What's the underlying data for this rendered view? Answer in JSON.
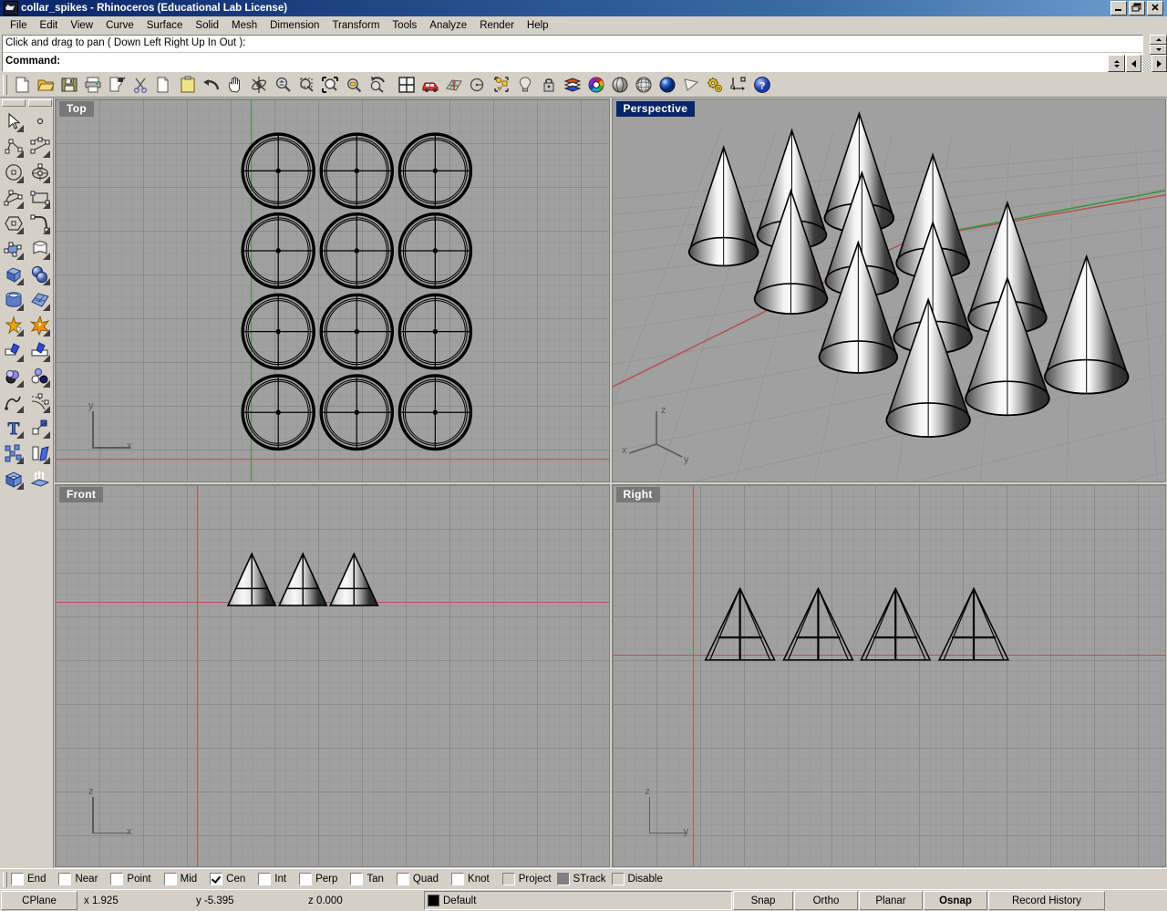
{
  "window": {
    "title": "collar_spikes - Rhinoceros (Educational Lab License)",
    "icon": "rhino-logo-icon",
    "buttons": {
      "minimize": "_",
      "restore": "❐",
      "close": "✕"
    }
  },
  "menubar": {
    "items": [
      {
        "label": "File"
      },
      {
        "label": "Edit"
      },
      {
        "label": "View"
      },
      {
        "label": "Curve"
      },
      {
        "label": "Surface"
      },
      {
        "label": "Solid"
      },
      {
        "label": "Mesh"
      },
      {
        "label": "Dimension"
      },
      {
        "label": "Transform"
      },
      {
        "label": "Tools"
      },
      {
        "label": "Analyze"
      },
      {
        "label": "Render"
      },
      {
        "label": "Help"
      }
    ]
  },
  "command_area": {
    "history": "Click and drag to pan ( Down  Left  Right  Up  In  Out ):",
    "prompt": "Command:",
    "input_value": ""
  },
  "toolbar": {
    "buttons": [
      {
        "name": "new-file-icon",
        "tip": "New"
      },
      {
        "name": "open-file-icon",
        "tip": "Open"
      },
      {
        "name": "save-file-icon",
        "tip": "Save"
      },
      {
        "name": "print-icon",
        "tip": "Print"
      },
      {
        "name": "copy-to-clipboard-icon",
        "tip": "Copy to clipboard"
      },
      {
        "name": "cut-scissors-icon",
        "tip": "Cut"
      },
      {
        "name": "copy-icon",
        "tip": "Copy"
      },
      {
        "name": "paste-icon",
        "tip": "Paste"
      },
      {
        "name": "undo-arrow-icon",
        "tip": "Undo"
      },
      {
        "name": "pan-hand-icon",
        "tip": "Pan"
      },
      {
        "name": "rotate-view-icon",
        "tip": "Rotate view"
      },
      {
        "name": "zoom-in-out-icon",
        "tip": "Zoom"
      },
      {
        "name": "zoom-window-icon",
        "tip": "Zoom window"
      },
      {
        "name": "zoom-extents-icon",
        "tip": "Zoom extents"
      },
      {
        "name": "zoom-selected-icon",
        "tip": "Zoom selected"
      },
      {
        "name": "undo-view-change-icon",
        "tip": "Undo view change"
      },
      {
        "name": "viewport-layout-icon",
        "tip": "Viewport layout"
      },
      {
        "name": "render-preview-car-icon",
        "tip": "Render preview"
      },
      {
        "name": "grid-surface-icon",
        "tip": "Grid"
      },
      {
        "name": "circle-tool-icon",
        "tip": "Circle"
      },
      {
        "name": "select-objects-icon",
        "tip": "Select objects"
      },
      {
        "name": "light-bulb-icon",
        "tip": "Lights"
      },
      {
        "name": "lock-icon",
        "tip": "Lock"
      },
      {
        "name": "layers-icon",
        "tip": "Layers"
      },
      {
        "name": "color-wheel-icon",
        "tip": "Object color"
      },
      {
        "name": "shaded-sphere-icon",
        "tip": "Shaded viewport"
      },
      {
        "name": "wireframe-sphere-icon",
        "tip": "Wireframe viewport"
      },
      {
        "name": "render-sphere-icon",
        "tip": "Render"
      },
      {
        "name": "spotlight-icon",
        "tip": "Spotlight"
      },
      {
        "name": "options-gears-icon",
        "tip": "Options"
      },
      {
        "name": "dimension-icon",
        "tip": "Dimension"
      },
      {
        "name": "help-icon",
        "tip": "Help"
      }
    ]
  },
  "sidebar": {
    "left_column": [
      {
        "name": "select-arrow-icon"
      },
      {
        "name": "polyline-icon"
      },
      {
        "name": "circle-icon"
      },
      {
        "name": "arc-icon"
      },
      {
        "name": "polygon-icon"
      },
      {
        "name": "control-points-icon"
      },
      {
        "name": "box-icon"
      },
      {
        "name": "cylinder-icon"
      },
      {
        "name": "boolean-icon"
      },
      {
        "name": "split-icon"
      },
      {
        "name": "boolean-union-icon"
      },
      {
        "name": "curve-icon"
      },
      {
        "name": "text-tool-icon"
      },
      {
        "name": "array-icon"
      },
      {
        "name": "cap-icon"
      }
    ],
    "right_column": [
      {
        "name": "point-icon"
      },
      {
        "name": "curve-interp-icon"
      },
      {
        "name": "ellipse-icon"
      },
      {
        "name": "rectangle-icon"
      },
      {
        "name": "corner-curve-icon"
      },
      {
        "name": "surface-icon"
      },
      {
        "name": "sphere-union-icon"
      },
      {
        "name": "surface-grid-icon"
      },
      {
        "name": "explode-icon"
      },
      {
        "name": "trim-icon"
      },
      {
        "name": "booleans-icon"
      },
      {
        "name": "offset-curve-icon"
      },
      {
        "name": "move-icon"
      },
      {
        "name": "mirror-icon"
      },
      {
        "name": "extrude-icon"
      }
    ]
  },
  "viewports": [
    {
      "name": "top",
      "label": "Top",
      "active": false,
      "display_mode": "wireframe",
      "axis_labels": {
        "horizontal": "x",
        "vertical": "y"
      },
      "geometry": {
        "shape": "cone",
        "count": 12,
        "columns": 3,
        "rows": 4,
        "view": "circles-top-down"
      }
    },
    {
      "name": "perspective",
      "label": "Perspective",
      "active": true,
      "display_mode": "shaded",
      "axis_labels": {
        "up": "z",
        "left": "x",
        "right": "y"
      },
      "geometry": {
        "shape": "cone",
        "count": 12,
        "columns": 3,
        "rows": 4,
        "view": "shaded-3d"
      }
    },
    {
      "name": "front",
      "label": "Front",
      "active": false,
      "display_mode": "shaded",
      "axis_labels": {
        "horizontal": "x",
        "vertical": "z"
      },
      "geometry": {
        "shape": "cone",
        "count": 3,
        "view": "shaded-triangles"
      }
    },
    {
      "name": "right",
      "label": "Right",
      "active": false,
      "display_mode": "wireframe",
      "axis_labels": {
        "horizontal": "y",
        "vertical": "z"
      },
      "geometry": {
        "shape": "cone",
        "count": 4,
        "view": "wireframe-triangles"
      }
    }
  ],
  "osnap": {
    "items": [
      {
        "label": "End",
        "checked": false,
        "style": "white"
      },
      {
        "label": "Near",
        "checked": false,
        "style": "white"
      },
      {
        "label": "Point",
        "checked": false,
        "style": "white"
      },
      {
        "label": "Mid",
        "checked": false,
        "style": "white"
      },
      {
        "label": "Cen",
        "checked": true,
        "style": "white"
      },
      {
        "label": "Int",
        "checked": false,
        "style": "white"
      },
      {
        "label": "Perp",
        "checked": false,
        "style": "white"
      },
      {
        "label": "Tan",
        "checked": false,
        "style": "white"
      },
      {
        "label": "Quad",
        "checked": false,
        "style": "white"
      },
      {
        "label": "Knot",
        "checked": false,
        "style": "white"
      },
      {
        "label": "Project",
        "checked": false,
        "style": "gray"
      },
      {
        "label": "STrack",
        "checked": false,
        "style": "dark"
      },
      {
        "label": "Disable",
        "checked": false,
        "style": "gray"
      }
    ]
  },
  "statusbar": {
    "cplane": "CPlane",
    "coord_x": "x 1.925",
    "coord_y": "y -5.395",
    "coord_z": "z 0.000",
    "layer": "Default",
    "layer_color": "#000000",
    "buttons": [
      {
        "label": "Snap",
        "active": false
      },
      {
        "label": "Ortho",
        "active": false
      },
      {
        "label": "Planar",
        "active": false
      },
      {
        "label": "Osnap",
        "active": true
      },
      {
        "label": "Record History",
        "active": false
      }
    ]
  },
  "colors": {
    "viewport_bg": "#a0a0a0",
    "axis_x": "#b05858",
    "axis_y": "#3f9440",
    "active_label_bg": "#0a246a",
    "inactive_label_bg": "#787878",
    "chrome": "#d4d0c8"
  }
}
